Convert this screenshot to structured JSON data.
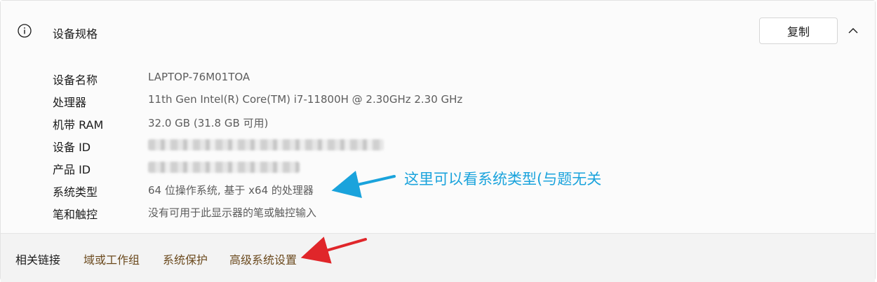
{
  "header": {
    "title": "设备规格",
    "copy_label": "复制",
    "info_icon": "info-icon",
    "collapse_icon": "chevron-up-icon"
  },
  "specs": [
    {
      "label": "设备名称",
      "value": "LAPTOP-76M01TOA"
    },
    {
      "label": "处理器",
      "value": "11th Gen Intel(R) Core(TM) i7-11800H @ 2.30GHz   2.30 GHz"
    },
    {
      "label": "机带 RAM",
      "value": "32.0 GB (31.8 GB 可用)"
    },
    {
      "label": "设备 ID",
      "value": ""
    },
    {
      "label": "产品 ID",
      "value": ""
    },
    {
      "label": "系统类型",
      "value": "64 位操作系统, 基于 x64 的处理器"
    },
    {
      "label": "笔和触控",
      "value": "没有可用于此显示器的笔或触控输入"
    }
  ],
  "annotation": {
    "text": "这里可以看系统类型(与题无关",
    "color": "#1aa3dc"
  },
  "footer": {
    "label": "相关链接",
    "links": [
      "域或工作组",
      "系统保护",
      "高级系统设置"
    ]
  },
  "colors": {
    "link": "#6b4a1e",
    "blue_arrow": "#1aa3dc",
    "red_arrow": "#e0262a"
  }
}
